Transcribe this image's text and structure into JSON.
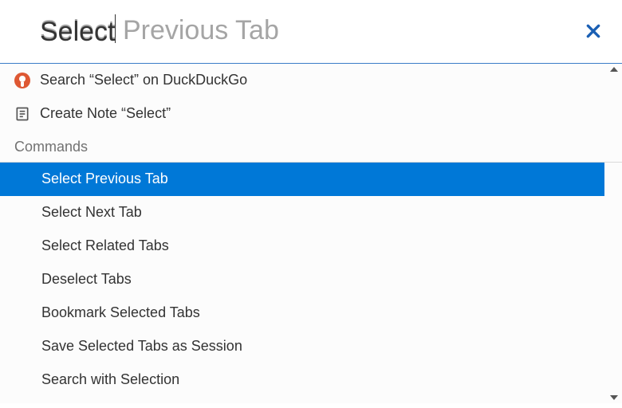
{
  "search": {
    "typed": "Select",
    "ghost": "Select Previous Tab"
  },
  "quick_actions": {
    "search_engine": "Search “Select” on DuckDuckGo",
    "create_note": "Create Note “Select”"
  },
  "sections": {
    "commands_header": "Commands"
  },
  "commands": {
    "items": [
      "Select Previous Tab",
      "Select Next Tab",
      "Select Related Tabs",
      "Deselect Tabs",
      "Bookmark Selected Tabs",
      "Save Selected Tabs as Session",
      "Search with Selection"
    ],
    "selected_index": 0
  },
  "colors": {
    "selection": "#0078D7",
    "accent": "#1a5fb4",
    "ddg": "#de5833"
  }
}
